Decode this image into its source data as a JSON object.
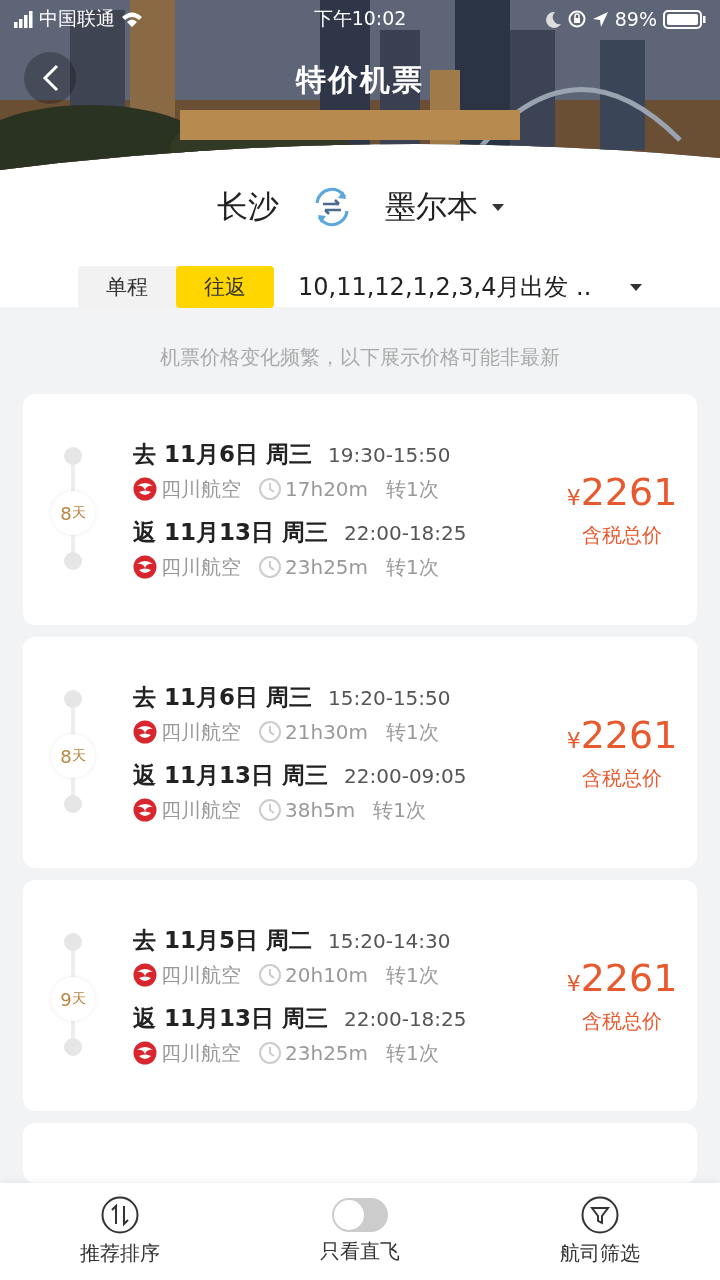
{
  "status_bar": {
    "carrier": "中国联通",
    "time": "下午10:02",
    "battery": "89%"
  },
  "header": {
    "title": "特价机票"
  },
  "route": {
    "from": "长沙",
    "to": "墨尔本"
  },
  "trip_types": [
    {
      "label": "单程",
      "selected": false
    },
    {
      "label": "往返",
      "selected": true
    }
  ],
  "date_filter": "10,11,12,1,2,3,4月出发 ..",
  "notice": "机票价格变化频繁，以下展示价格可能非最新",
  "results": [
    {
      "days": "8",
      "days_unit": "天",
      "price_symbol": "¥",
      "price": "2261",
      "price_note": "含税总价",
      "legs": [
        {
          "direction": "去",
          "date": "11月6日 周三",
          "times": "19:30-15:50",
          "airline": "四川航空",
          "duration": "17h20m",
          "stops": "转1次"
        },
        {
          "direction": "返",
          "date": "11月13日 周三",
          "times": "22:00-18:25",
          "airline": "四川航空",
          "duration": "23h25m",
          "stops": "转1次"
        }
      ]
    },
    {
      "days": "8",
      "days_unit": "天",
      "price_symbol": "¥",
      "price": "2261",
      "price_note": "含税总价",
      "legs": [
        {
          "direction": "去",
          "date": "11月6日 周三",
          "times": "15:20-15:50",
          "airline": "四川航空",
          "duration": "21h30m",
          "stops": "转1次"
        },
        {
          "direction": "返",
          "date": "11月13日 周三",
          "times": "22:00-09:05",
          "airline": "四川航空",
          "duration": "38h5m",
          "stops": "转1次"
        }
      ]
    },
    {
      "days": "9",
      "days_unit": "天",
      "price_symbol": "¥",
      "price": "2261",
      "price_note": "含税总价",
      "legs": [
        {
          "direction": "去",
          "date": "11月5日 周二",
          "times": "15:20-14:30",
          "airline": "四川航空",
          "duration": "20h10m",
          "stops": "转1次"
        },
        {
          "direction": "返",
          "date": "11月13日 周三",
          "times": "22:00-18:25",
          "airline": "四川航空",
          "duration": "23h25m",
          "stops": "转1次"
        }
      ]
    }
  ],
  "bottom_bar": [
    {
      "kind": "sort",
      "label": "推荐排序"
    },
    {
      "kind": "toggle",
      "label": "只看直飞",
      "on": false
    },
    {
      "kind": "filter",
      "label": "航司筛选"
    }
  ]
}
